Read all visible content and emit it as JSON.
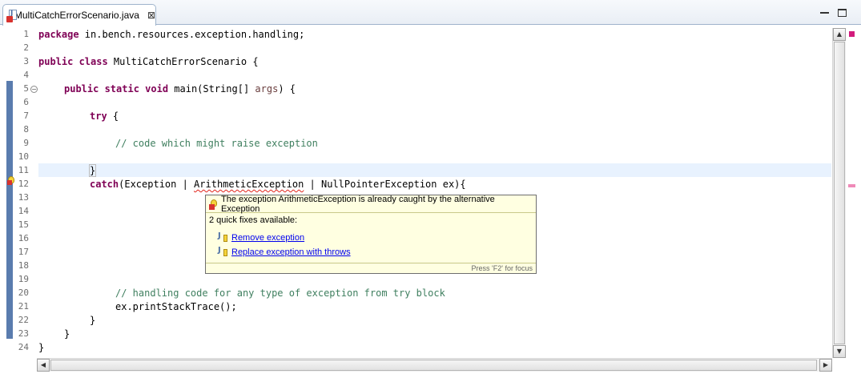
{
  "tab": {
    "title": "MultiCatchErrorScenario.java",
    "close_glyph": "⊠"
  },
  "gutter": {
    "line_numbers": [
      "1",
      "2",
      "3",
      "4",
      "5",
      "6",
      "7",
      "8",
      "9",
      "10",
      "11",
      "12",
      "13",
      "14",
      "15",
      "16",
      "17",
      "18",
      "19",
      "20",
      "21",
      "22",
      "23",
      "24"
    ]
  },
  "code": {
    "l1_kw": "package",
    "l1_rest": " in.bench.resources.exception.handling;",
    "l3_kw": "public class",
    "l3_rest": " MultiCatchErrorScenario {",
    "l5_kw": "public static void",
    "l5_rest": " main(String[] ",
    "l5_param": "args",
    "l5_end": ") {",
    "l7_kw": "try",
    "l7_rest": " {",
    "l9_comment": "// code which might raise exception",
    "l11_text": "}",
    "l12_kw": "catch",
    "l12_a": "(Exception | ",
    "l12_err": "ArithmeticException",
    "l12_b": " | NullPointerException ex){",
    "l20_comment": "// handling code for any type of exception from try block",
    "l21_text": "ex.printStackTrace();",
    "l22_text": "}",
    "l23_text": "}",
    "l24_text": "}"
  },
  "popup": {
    "message": "The exception ArithmeticException is already caught by the alternative Exception",
    "subtitle": "2 quick fixes available:",
    "fixes": [
      "Remove exception",
      "Replace exception with throws"
    ],
    "footer": "Press 'F2' for focus"
  },
  "colors": {
    "keyword": "#7f0055",
    "comment": "#3f7f5f",
    "error": "#e2241b",
    "current_line": "#e8f2fe"
  }
}
